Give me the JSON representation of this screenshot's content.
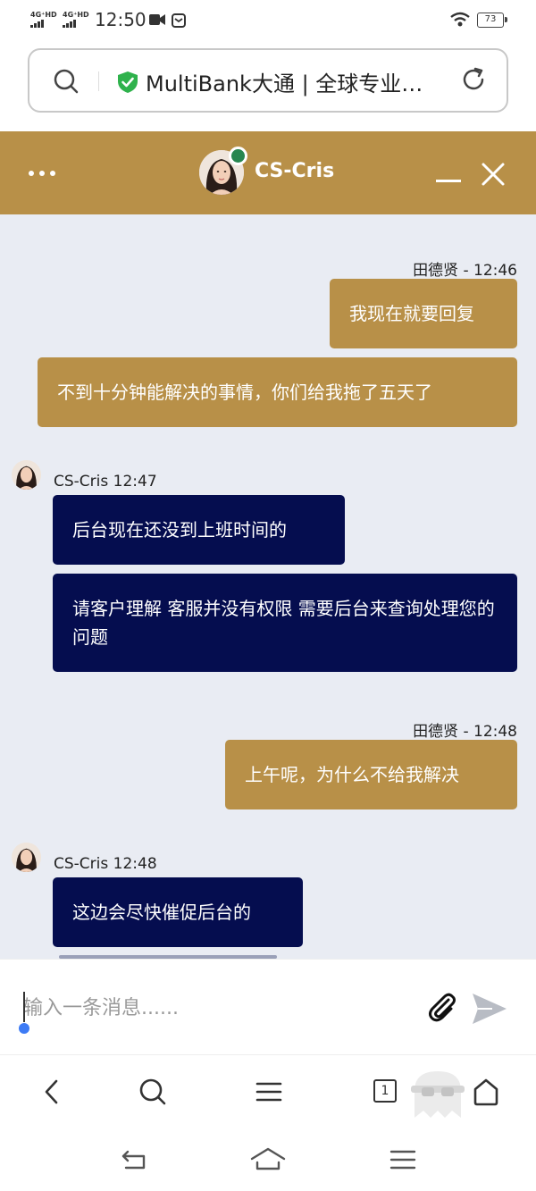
{
  "status_bar": {
    "network_1": "4G⁺HD",
    "network_2": "4G⁺HD",
    "time": "12:50",
    "battery": "73"
  },
  "browser": {
    "url_text": "MultiBank大通 | 全球专业…",
    "tab_count": "1"
  },
  "chat": {
    "agent_name": "CS-Cris",
    "messages": [
      {
        "direction": "out",
        "meta": "田德贤 - 12:46",
        "text": "我现在就要回复"
      },
      {
        "direction": "out",
        "meta": "",
        "text": "不到十分钟能解决的事情，你们给我拖了五天了"
      },
      {
        "direction": "in",
        "meta": "CS-Cris 12:47",
        "text": "后台现在还没到上班时间的"
      },
      {
        "direction": "in",
        "meta": "",
        "text": "请客户理解 客服并没有权限 需要后台来查询处理您的问题"
      },
      {
        "direction": "out",
        "meta": "田德贤 - 12:48",
        "text": "上午呢，为什么不给我解决"
      },
      {
        "direction": "in",
        "meta": "CS-Cris 12:48",
        "text": "这边会尽快催促后台的"
      }
    ]
  },
  "composer": {
    "placeholder": "输入一条消息......"
  },
  "icons": {
    "menu": "more-dots-icon",
    "minimize": "minimize-icon",
    "close": "close-icon",
    "attach": "paperclip-icon",
    "send": "send-icon"
  },
  "colors": {
    "brand_gold": "#b89048",
    "agent_bubble": "#050d4f",
    "chat_background": "#e9ecf3",
    "online": "#27864f"
  }
}
